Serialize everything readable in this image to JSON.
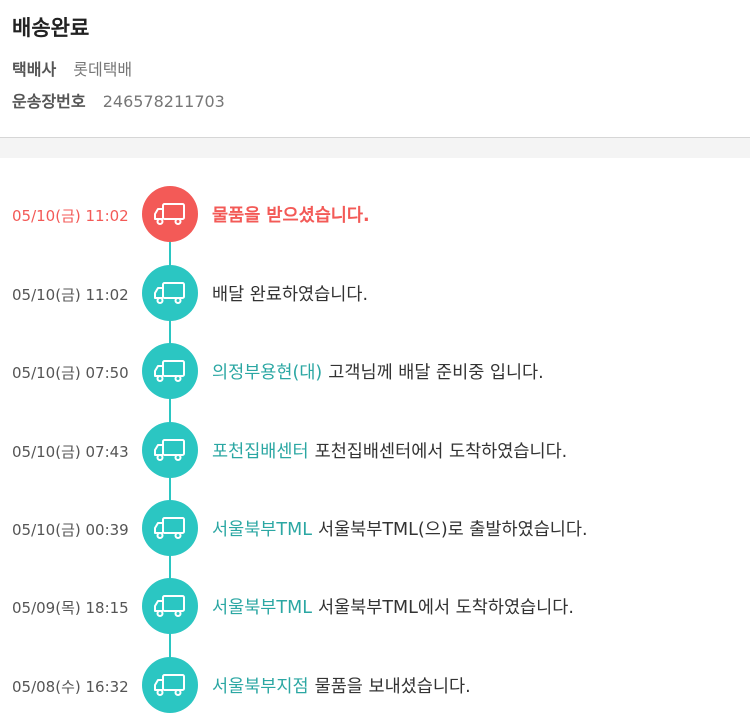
{
  "header": {
    "title": "배송완료",
    "courier_label": "택배사",
    "courier_value": "롯데택배",
    "tracking_label": "운송장번호",
    "tracking_value": "246578211703"
  },
  "colors": {
    "accent": "#2bc6c2",
    "highlight": "#f35a57",
    "location_text": "#2ba7a3"
  },
  "events": [
    {
      "time": "05/10(금) 11:02",
      "location": "",
      "message": "물품을 받으셨습니다.",
      "icon": "truck-icon"
    },
    {
      "time": "05/10(금) 11:02",
      "location": "",
      "message": "배달 완료하였습니다.",
      "icon": "truck-icon"
    },
    {
      "time": "05/10(금) 07:50",
      "location": "의정부용현(대)",
      "message": "고객님께 배달 준비중 입니다.",
      "icon": "truck-icon"
    },
    {
      "time": "05/10(금) 07:43",
      "location": "포천집배센터",
      "message": "포천집배센터에서 도착하였습니다.",
      "icon": "truck-icon"
    },
    {
      "time": "05/10(금) 00:39",
      "location": "서울북부TML",
      "message": "서울북부TML(으)로 출발하였습니다.",
      "icon": "truck-icon"
    },
    {
      "time": "05/09(목) 18:15",
      "location": "서울북부TML",
      "message": "서울북부TML에서 도착하였습니다.",
      "icon": "truck-icon"
    },
    {
      "time": "05/08(수) 16:32",
      "location": "서울북부지점",
      "message": "물품을 보내셨습니다.",
      "icon": "truck-icon"
    }
  ]
}
